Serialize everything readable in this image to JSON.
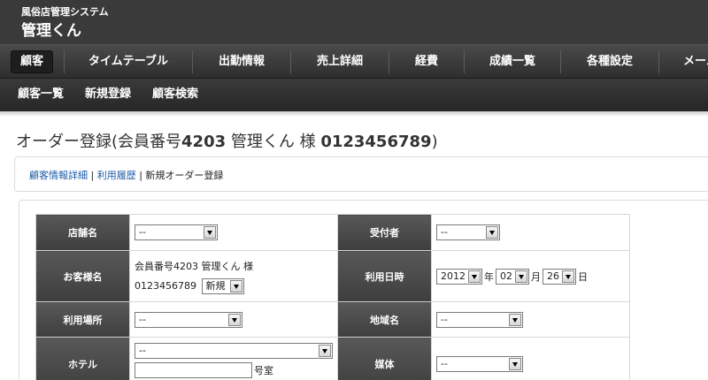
{
  "header": {
    "subtitle": "風俗店管理システム",
    "title": "管理くん"
  },
  "main_nav": {
    "items": [
      {
        "label": "顧客",
        "active": true
      },
      {
        "label": "タイムテーブル"
      },
      {
        "label": "出勤情報"
      },
      {
        "label": "売上詳細"
      },
      {
        "label": "経費"
      },
      {
        "label": "成績一覧"
      },
      {
        "label": "各種設定"
      },
      {
        "label": "メール"
      }
    ]
  },
  "sub_nav": {
    "items": [
      {
        "label": "顧客一覧"
      },
      {
        "label": "新規登録"
      },
      {
        "label": "顧客検索"
      }
    ]
  },
  "page": {
    "title_prefix": "オーダー登録(会員番号",
    "member_no": "4203",
    "title_mid": " 管理くん 様 ",
    "phone": "0123456789",
    "title_suffix": ")"
  },
  "breadcrumb": {
    "link1": "顧客情報詳細",
    "sep": " | ",
    "link2": "利用履歴",
    "current": "新規オーダー登録"
  },
  "form": {
    "store_label": "店舗名",
    "store_value": "--",
    "receiver_label": "受付者",
    "receiver_value": "--",
    "customer_label": "お客様名",
    "customer_line1": "会員番号4203 管理くん 様",
    "customer_phone": "0123456789",
    "customer_type_value": "新規",
    "datetime_label": "利用日時",
    "year_value": "2012",
    "year_unit": "年",
    "month_value": "02",
    "month_unit": "月",
    "day_value": "26",
    "day_unit": "日",
    "place_label": "利用場所",
    "place_value": "--",
    "area_label": "地域名",
    "area_value": "--",
    "hotel_label": "ホテル",
    "hotel_value": "--",
    "room_unit": "号室",
    "media_label": "媒体",
    "media_value": "--"
  }
}
